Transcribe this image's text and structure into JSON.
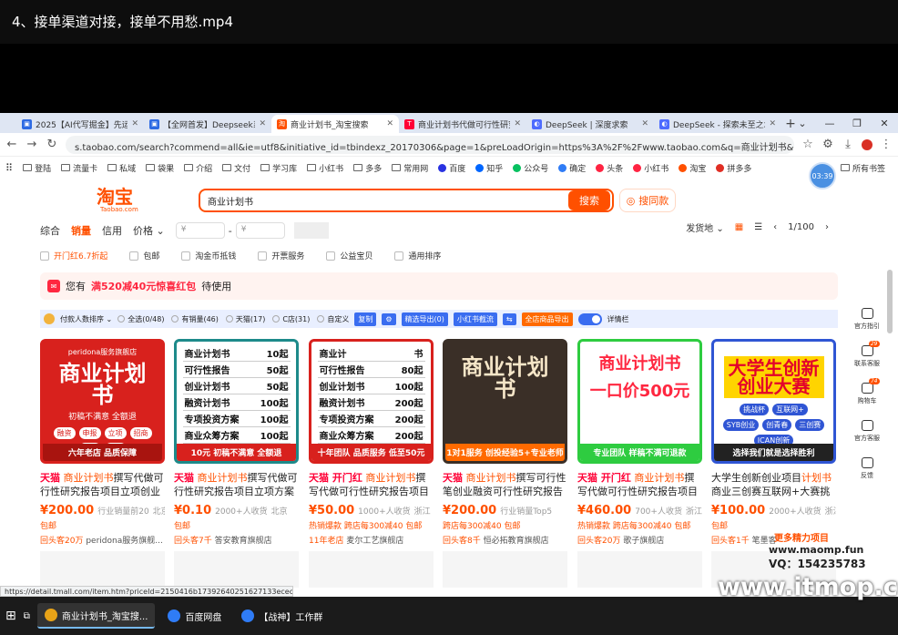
{
  "video_title": "4、接单渠道对接，接单不用愁.mp4",
  "tabs": [
    {
      "label": "2025【AI代写掘金】先运",
      "fav": "#2d6ae3",
      "fav_text": "▣"
    },
    {
      "label": "【全网首发】Deepseek系列",
      "fav": "#2d6ae3",
      "fav_text": "▣"
    },
    {
      "label": "商业计划书_淘宝搜索",
      "fav": "#ff5000",
      "fav_text": "淘"
    },
    {
      "label": "商业计划书代做可行性研究",
      "fav": "#ff0036",
      "fav_text": "T"
    },
    {
      "label": "DeepSeek | 深度求索",
      "fav": "#4d6bfe",
      "fav_text": "◐"
    },
    {
      "label": "DeepSeek - 探索未至之境",
      "fav": "#4d6bfe",
      "fav_text": "◐"
    }
  ],
  "url": "s.taobao.com/search?commend=all&ie=utf8&initiative_id=tbindexz_20170306&page=1&preLoadOrigin=https%3A%2F%2Fwww.taobao.com&q=商业计划书&search_type...",
  "bookmarks": [
    "登陆",
    "流量卡",
    "私域",
    "袋果",
    "介绍",
    "文付",
    "学习库",
    "小红书",
    "多多",
    "常用网",
    "百度",
    "知乎",
    "公众号",
    "确定",
    "头条",
    "小红书",
    "淘宝",
    "拼多多"
  ],
  "all_bookmarks": "所有书签",
  "timer": "03:39",
  "logo": "淘宝",
  "logo_sub": "Taobao.com",
  "search_query": "商业计划书",
  "search_btn": "搜索",
  "same_btn": "搜同款",
  "sort": {
    "items": [
      "综合",
      "销量",
      "信用",
      "价格"
    ],
    "price_placeholder": "¥",
    "ship": "发货地",
    "page": "1/100"
  },
  "filters": [
    "开门红6.7折起",
    "包邮",
    "淘金币抵钱",
    "开票服务",
    "公益宝贝",
    "通用排序"
  ],
  "coupon": {
    "pre": "您有",
    "highlight": "满520减40元惊喜红包",
    "post": "待使用"
  },
  "plugin": {
    "label": "付款人数排序",
    "items": [
      "全选(0/48)",
      "有销量(46)",
      "天猫(17)",
      "C店(31)",
      "自定义"
    ],
    "b1": "复制",
    "b2": "精选导出(0)",
    "b3": "小红书截流",
    "b4": "全店商品导出",
    "toggle": "详情栏"
  },
  "products": [
    {
      "price": "¥200.00",
      "meta": "行业销量前20",
      "loc": "北京",
      "prefix": "天猫",
      "kw": "商业计划书",
      "rest": "撰写代做可行性研究报告项目立项创业融...",
      "tag": "包邮",
      "shop": "回头客20万",
      "shopname": "peridona服务旗舰...",
      "img_top": "peridona服务旗舰店",
      "img_big": "商业计划书",
      "img_bottom": "六年老店 品质保障",
      "pills": [
        "融资",
        "申报",
        "立项",
        "招商",
        "创业",
        "投标"
      ],
      "img_mid": "初稿不满意 全额退"
    },
    {
      "price": "¥0.10",
      "meta": "2000+人收货",
      "loc": "北京",
      "prefix": "天猫",
      "kw": "商业计划书",
      "rest": "撰写代做可行性研究报告项目立项方案策...",
      "tag": "包邮",
      "shop": "回头客7千",
      "shopname": "答安教育旗舰店",
      "rows": [
        [
          "商业计划书",
          "10起"
        ],
        [
          "可行性报告",
          "50起"
        ],
        [
          "创业计划书",
          "50起"
        ],
        [
          "融资计划书",
          "100起"
        ],
        [
          "专项投资方案",
          "100起"
        ],
        [
          "商业众筹方案",
          "100起"
        ]
      ],
      "img_bottom": "10元 初稿不满意 全额退"
    },
    {
      "price": "¥50.00",
      "meta": "1000+人收货",
      "loc": "浙江",
      "prefix": "天猫 开门红",
      "kw": "商业计划书",
      "rest": "撰写代做可行性研究报告项目立项...",
      "tag": "热销爆款 跨店每300减40 包邮",
      "shop": "11年老店",
      "shopname": "麦尔工艺旗舰店",
      "rows": [
        [
          "商业计",
          "书"
        ],
        [
          "可行性报告",
          "80起"
        ],
        [
          "创业计划书",
          "100起"
        ],
        [
          "融资计划书",
          "200起"
        ],
        [
          "专项投资方案",
          "200起"
        ],
        [
          "商业众筹方案",
          "200起"
        ]
      ],
      "img_bottom": "十年团队 品质服务 低至50元"
    },
    {
      "price": "¥200.00",
      "meta": "行业销量Top5",
      "loc": "",
      "prefix": "天猫",
      "kw": "商业计划书",
      "rest": "撰写可行性笔创业融资可行性研究报告项目可...",
      "tag": "跨店每300减40 包邮",
      "shop": "回头客8千",
      "shopname": "恒必拓教育旗舰店",
      "img_big": "商业计划书",
      "img_bottom": "1对1服务 创投经验5+专业老师"
    },
    {
      "price": "¥460.00",
      "meta": "700+人收货",
      "loc": "浙江",
      "prefix": "天猫 开门红",
      "kw": "商业计划书",
      "rest": "撰写代做可行性研究报告项目立项...",
      "tag": "热销爆款 跨店每300减40 包邮",
      "shop": "回头客20万",
      "shopname": "歌子旗舰店",
      "img_big": "商业计划书",
      "img_mid": "一口价500元",
      "img_bottom": "专业团队 样稿不满可退款"
    },
    {
      "price": "¥100.00",
      "meta": "2000+人收货",
      "loc": "浙江",
      "prefix": "",
      "kw": "计划书",
      "rest": "商业三创赛互联网+大赛挑战...",
      "pre_title": "大学生创新创业项目",
      "tag": "包邮",
      "shop": "回头客1千",
      "shopname": "笔墨客",
      "img_big": "大学生创新 创业大赛",
      "img_bottom": "选择我们就是选择胜利",
      "pills": [
        "挑战杯",
        "互联网+",
        "SYB创业",
        "创青春",
        "三创赛",
        "ICAN创新"
      ]
    }
  ],
  "sidebar": [
    "官方指引",
    "联系客服",
    "购物车",
    "官方客服",
    "反馈"
  ],
  "sidebar_badges": [
    "",
    "29",
    "74",
    "",
    ""
  ],
  "status_url": "https://detail.tmall.com/item.htm?priceId=2150416b17392640251627133ececa&utp...",
  "taskbar": [
    {
      "label": "商业计划书_淘宝搜...",
      "color": "#e8a317"
    },
    {
      "label": "百度网盘",
      "color": "#2f7cf6"
    },
    {
      "label": "【战神】工作群",
      "color": "#2f7cf6"
    }
  ],
  "watermarks": {
    "a": "更多精力项目",
    "b": "www.maomp.fun",
    "c": "VQ：154235783",
    "d": "www.itmop.com"
  }
}
